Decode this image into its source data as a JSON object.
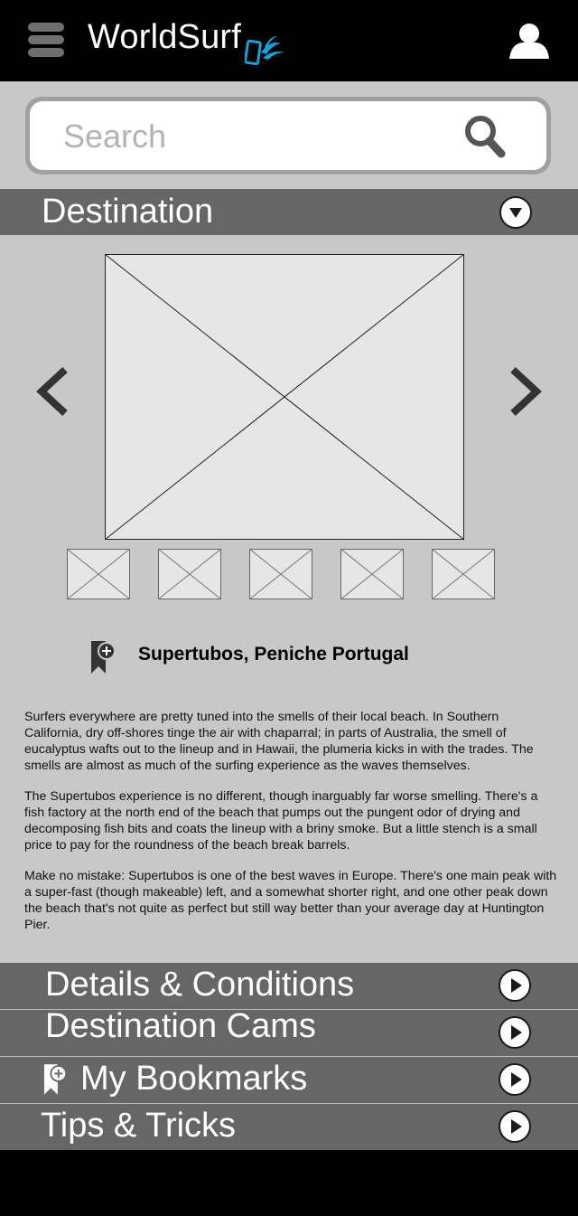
{
  "app": {
    "title_text": "WorldSurf"
  },
  "icons": {
    "menu": "hamburger-icon",
    "profile": "user-icon",
    "search": "search-icon",
    "dropdown": "chevron-down-circle-icon",
    "prev": "chevron-left-icon",
    "next": "chevron-right-icon",
    "bookmark": "bookmark-add-icon",
    "expand": "play-circle-icon"
  },
  "search": {
    "placeholder": "Search",
    "value": ""
  },
  "destination": {
    "heading": "Destination",
    "thumbnail_count": 5,
    "location_name": "Supertubos, Peniche Portugal",
    "description": [
      "Surfers everywhere are pretty tuned into the smells of their local beach. In Southern California, dry off-shores tinge the air with chaparral; in parts of Australia, the smell of eucalyptus wafts out to the lineup and in Hawaii, the plumeria kicks in with the trades. The smells are almost as much of the surfing experience as the waves themselves.",
      "The Supertubos experience is no different, though inarguably far worse smelling. There's a fish factory at the north end of the beach that pumps out the pungent odor of drying and decomposing fish bits and coats the lineup with a briny smoke. But a little stench is a small price to pay for the roundness of the beach break barrels.",
      "Make no mistake: Supertubos is one of the best waves in Europe. There's one main peak with a super-fast (though makeable) left, and a somewhat shorter right, and one other peak down the beach that's not quite as perfect but still way better than your average day at Huntington Pier."
    ]
  },
  "sections": [
    {
      "label": "Details & Conditions"
    },
    {
      "label": "Destination Cams"
    },
    {
      "label": "My Bookmarks"
    },
    {
      "label": "Tips & Tricks"
    }
  ],
  "colors": {
    "background": "#c8c8c8",
    "section_bar": "#666666",
    "header": "#000000",
    "logo_accent": "#1b9fd6"
  }
}
